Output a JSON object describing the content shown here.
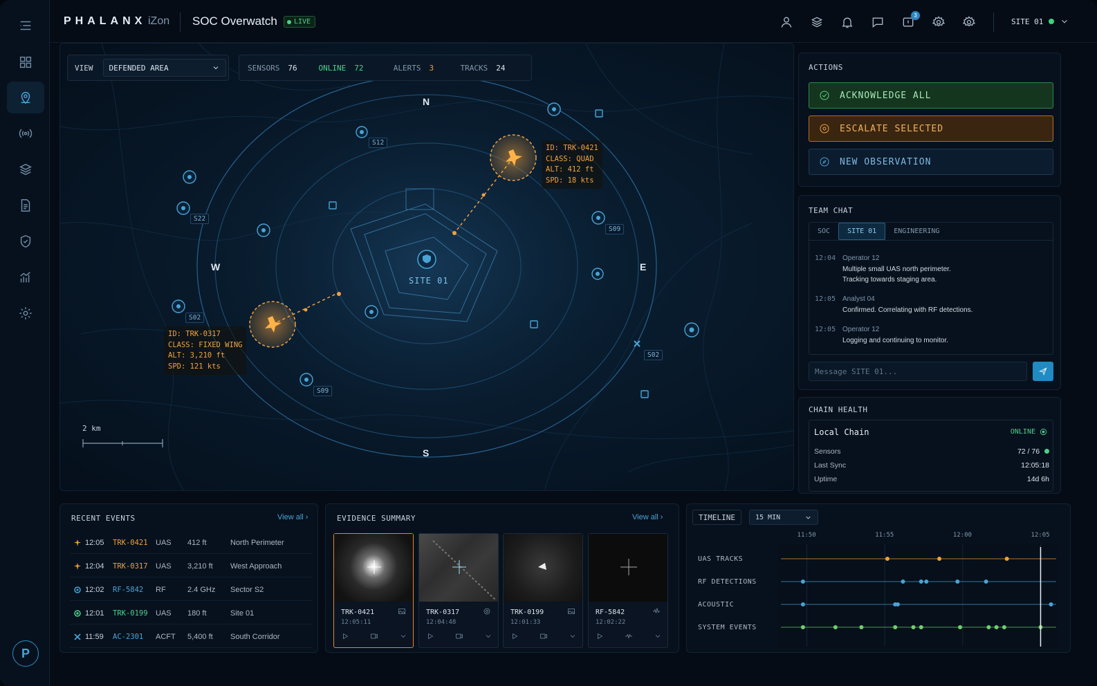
{
  "header": {
    "brand": "PHALANX",
    "brand_sub": "iZon",
    "title": "SOC Overwatch",
    "live_label": "LIVE",
    "notification_count": "3",
    "site_selector": "SITE 01"
  },
  "sidebar": {
    "items": [
      "dashboard-icon",
      "map-pin-icon",
      "sensors-icon",
      "layers-icon",
      "reports-icon",
      "shield-icon",
      "analytics-icon",
      "settings-icon"
    ],
    "active": "map-pin-icon",
    "logo": "P"
  },
  "map": {
    "view_label": "VIEW",
    "view_value": "DEFENDED AREA",
    "stats": [
      {
        "label": "SENSORS",
        "value": "76",
        "color": "#8097ab"
      },
      {
        "label": "ONLINE",
        "value": "72",
        "color": "#4fd08a"
      },
      {
        "label": "ALERTS",
        "value": "3",
        "color": "#8097ab"
      },
      {
        "label": "TRACKS",
        "value": "24",
        "color": "#8097ab"
      }
    ],
    "compass": {
      "n": "N",
      "s": "S",
      "e": "E",
      "w": "W"
    },
    "site_label": "SITE 01",
    "scale_label": "2 km",
    "sensor_tags": [
      "S12",
      "S22",
      "S02",
      "S09",
      "S09",
      "S02"
    ],
    "tracks": [
      {
        "lines": [
          "ID: TRK-0421",
          "CLASS: QUAD",
          "ALT: 412 ft",
          "SPD: 18 kts"
        ]
      },
      {
        "lines": [
          "ID: TRK-0317",
          "CLASS: FIXED WING",
          "ALT: 3,210 ft",
          "SPD: 121 kts"
        ]
      }
    ]
  },
  "actions": {
    "title": "ACTIONS",
    "acknowledge": "ACKNOWLEDGE ALL",
    "escalate": "ESCALATE SELECTED",
    "new_observation": "NEW OBSERVATION"
  },
  "chat": {
    "title": "TEAM CHAT",
    "tabs": [
      "SOC",
      "SITE 01",
      "ENGINEERING"
    ],
    "active_tab": "SITE 01",
    "messages": [
      {
        "time": "12:04",
        "author": "Operator 12",
        "text": "Multiple small UAS north perimeter.",
        "text2": "Tracking towards staging area."
      },
      {
        "time": "12:05",
        "author": "Analyst 04",
        "text": "Confirmed. Correlating with RF detections.",
        "text2": ""
      },
      {
        "time": "12:05",
        "author": "Operator 12",
        "text": "Logging and continuing to monitor.",
        "text2": ""
      }
    ],
    "placeholder": "Message SITE 01..."
  },
  "chain": {
    "title": "CHAIN HEALTH",
    "name": "Local Chain",
    "status": "ONLINE",
    "rows": [
      {
        "k": "Sensors",
        "v": "72 / 76"
      },
      {
        "k": "Last Sync",
        "v": "12:05:18"
      },
      {
        "k": "Uptime",
        "v": "14d 6h"
      }
    ]
  },
  "events": {
    "title": "RECENT EVENTS",
    "view_all": "View all",
    "rows": [
      {
        "icon": "plane-icon",
        "color": "#f0a040",
        "time": "12:05",
        "id": "TRK-0421",
        "type": "UAS",
        "alt": "412 ft",
        "loc": "North Perimeter"
      },
      {
        "icon": "plane-icon",
        "color": "#f0a040",
        "time": "12:04",
        "id": "TRK-0317",
        "type": "UAS",
        "alt": "3,210 ft",
        "loc": "West Approach"
      },
      {
        "icon": "rf-icon",
        "color": "#4aa3d6",
        "time": "12:02",
        "id": "RF-5842",
        "type": "RF",
        "alt": "2.4 GHz",
        "loc": "Sector S2"
      },
      {
        "icon": "target-icon",
        "color": "#4fd08a",
        "time": "12:01",
        "id": "TRK-0199",
        "type": "UAS",
        "alt": "180 ft",
        "loc": "Site 01"
      },
      {
        "icon": "aircraft-icon",
        "color": "#4aa3d6",
        "time": "11:59",
        "id": "AC-2301",
        "type": "ACFT",
        "alt": "5,400 ft",
        "loc": "South Corridor"
      }
    ]
  },
  "evidence": {
    "title": "EVIDENCE SUMMARY",
    "view_all": "View all",
    "items": [
      {
        "name": "TRK-0421",
        "time": "12:05:11"
      },
      {
        "name": "TRK-0317",
        "time": "12:04:48"
      },
      {
        "name": "TRK-0199",
        "time": "12:01:33"
      },
      {
        "name": "RF-5842",
        "time": "12:02:22"
      }
    ]
  },
  "timeline": {
    "title": "TIMELINE",
    "range": "15 MIN",
    "ticks": [
      "11:50",
      "11:55",
      "12:00",
      "12:05"
    ],
    "lanes": [
      {
        "name": "UAS TRACKS",
        "color": "#f0a040",
        "events": [
          "11:55:10",
          "11:58:30",
          "12:02:50"
        ]
      },
      {
        "name": "RF DETECTIONS",
        "color": "#4aa3d6",
        "events": [
          "11:49:45",
          "11:56:10",
          "11:57:20",
          "11:57:40",
          "11:59:40",
          "12:01:30"
        ]
      },
      {
        "name": "ACOUSTIC",
        "color": "#4aa3d6",
        "events": [
          "11:49:45",
          "11:55:40",
          "11:55:50",
          "12:05:40"
        ]
      },
      {
        "name": "SYSTEM EVENTS",
        "color": "#6fd06a",
        "events": [
          "11:49:45",
          "11:51:50",
          "11:53:30",
          "11:55:40",
          "11:56:50",
          "11:57:20",
          "11:59:50",
          "12:01:40",
          "12:02:10",
          "12:02:40",
          "12:05:00"
        ]
      }
    ]
  }
}
